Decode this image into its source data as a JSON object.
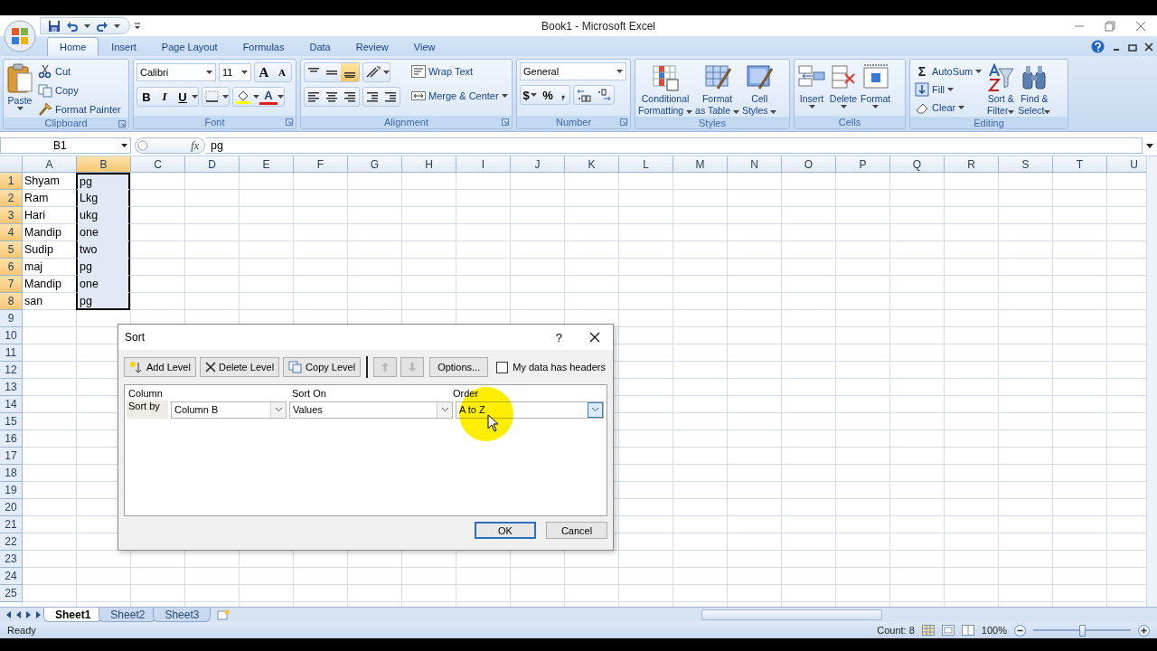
{
  "window": {
    "title": "Book1 - Microsoft Excel"
  },
  "ribbon_tabs": [
    {
      "label": "Home",
      "selected": true
    },
    {
      "label": "Insert",
      "selected": false
    },
    {
      "label": "Page Layout",
      "selected": false
    },
    {
      "label": "Formulas",
      "selected": false
    },
    {
      "label": "Data",
      "selected": false
    },
    {
      "label": "Review",
      "selected": false
    },
    {
      "label": "View",
      "selected": false
    }
  ],
  "ribbon_groups": [
    {
      "kind": "clipboard",
      "label": "Clipboard",
      "paste": "Paste",
      "commands": [
        "Cut",
        "Copy",
        "Format Painter"
      ]
    },
    {
      "kind": "font",
      "label": "Font",
      "font": "Calibri",
      "size": "11",
      "grow": "A",
      "shrink": "A",
      "styles": [
        "B",
        "I",
        "U"
      ],
      "font_color": "A"
    },
    {
      "kind": "alignment",
      "label": "Alignment",
      "commands": [
        "Wrap Text",
        "Merge & Center"
      ]
    },
    {
      "kind": "number",
      "label": "Number",
      "format": "General",
      "symbols": [
        "$",
        "%"
      ]
    },
    {
      "kind": "styles",
      "label": "Styles",
      "commands": [
        [
          "Conditional",
          "Formatting"
        ],
        [
          "Format",
          "as Table"
        ],
        [
          "Cell",
          "Styles"
        ]
      ]
    },
    {
      "kind": "cells",
      "label": "Cells",
      "commands": [
        "Insert",
        "Delete",
        "Format"
      ]
    },
    {
      "kind": "editing",
      "label": "Editing",
      "sigma": "Σ",
      "commands": [
        "AutoSum",
        "Fill",
        "Clear"
      ],
      "large": [
        [
          "Sort &",
          "Filter"
        ],
        [
          "Find &",
          "Select"
        ]
      ]
    }
  ],
  "formula_bar": {
    "name_box": "B1",
    "function_label": "fx",
    "value": "pg"
  },
  "columns": [
    {
      "label": "A",
      "selected": false
    },
    {
      "label": "B",
      "selected": true
    },
    {
      "label": "C",
      "selected": false
    },
    {
      "label": "D",
      "selected": false
    },
    {
      "label": "E",
      "selected": false
    },
    {
      "label": "F",
      "selected": false
    },
    {
      "label": "G",
      "selected": false
    },
    {
      "label": "H",
      "selected": false
    },
    {
      "label": "I",
      "selected": false
    },
    {
      "label": "J",
      "selected": false
    },
    {
      "label": "K",
      "selected": false
    },
    {
      "label": "L",
      "selected": false
    },
    {
      "label": "M",
      "selected": false
    },
    {
      "label": "N",
      "selected": false
    },
    {
      "label": "O",
      "selected": false
    },
    {
      "label": "P",
      "selected": false
    },
    {
      "label": "Q",
      "selected": false
    },
    {
      "label": "R",
      "selected": false
    },
    {
      "label": "S",
      "selected": false
    },
    {
      "label": "T",
      "selected": false
    },
    {
      "label": "U",
      "selected": false
    }
  ],
  "rows": [
    {
      "header": "1",
      "selected": true,
      "cells": [
        "Shyam",
        "pg"
      ]
    },
    {
      "header": "2",
      "selected": true,
      "cells": [
        "Ram",
        "Lkg"
      ]
    },
    {
      "header": "3",
      "selected": true,
      "cells": [
        "Hari",
        "ukg"
      ]
    },
    {
      "header": "4",
      "selected": true,
      "cells": [
        "Mandip",
        "one"
      ]
    },
    {
      "header": "5",
      "selected": true,
      "cells": [
        "Sudip",
        "two"
      ]
    },
    {
      "header": "6",
      "selected": true,
      "cells": [
        "maj",
        "pg"
      ]
    },
    {
      "header": "7",
      "selected": true,
      "cells": [
        "Mandip",
        "one"
      ]
    },
    {
      "header": "8",
      "selected": true,
      "cells": [
        "san",
        "pg"
      ]
    },
    {
      "header": "9",
      "selected": false
    },
    {
      "header": "10",
      "selected": false
    },
    {
      "header": "11",
      "selected": false
    },
    {
      "header": "12",
      "selected": false
    },
    {
      "header": "13",
      "selected": false
    },
    {
      "header": "14",
      "selected": false
    },
    {
      "header": "15",
      "selected": false
    },
    {
      "header": "16",
      "selected": false
    },
    {
      "header": "17",
      "selected": false
    },
    {
      "header": "18",
      "selected": false
    },
    {
      "header": "19",
      "selected": false
    },
    {
      "header": "20",
      "selected": false
    },
    {
      "header": "21",
      "selected": false
    },
    {
      "header": "22",
      "selected": false
    },
    {
      "header": "23",
      "selected": false
    },
    {
      "header": "24",
      "selected": false
    },
    {
      "header": "25",
      "selected": false
    }
  ],
  "sort_dialog": {
    "title": "Sort",
    "help": "?",
    "toolbar": [
      {
        "kind": "add",
        "label": "Add Level"
      },
      {
        "kind": "delete",
        "label": "Delete Level"
      },
      {
        "kind": "copy",
        "label": "Copy Level"
      }
    ],
    "move_buttons": [
      {
        "kind": "up",
        "disabled": true
      },
      {
        "kind": "down",
        "disabled": true
      }
    ],
    "options": "Options...",
    "headers_checkbox": {
      "label": "My data has headers",
      "checked": false
    },
    "columns": [
      "Column",
      "Sort On",
      "Order"
    ],
    "levels": [
      {
        "label": "Sort by",
        "column": "Column B",
        "sort_on": "Values",
        "order": "A to Z"
      }
    ],
    "buttons": [
      {
        "label": "OK",
        "focused": true
      },
      {
        "label": "Cancel",
        "focused": false
      }
    ]
  },
  "sheet_tabs": [
    {
      "label": "Sheet1",
      "selected": true
    },
    {
      "label": "Sheet2",
      "selected": false
    },
    {
      "label": "Sheet3",
      "selected": false
    }
  ],
  "status_bar": {
    "status": "Ready",
    "count": "Count: 8",
    "zoom": "100%",
    "zoom_slider": {
      "level": 0.5
    }
  }
}
